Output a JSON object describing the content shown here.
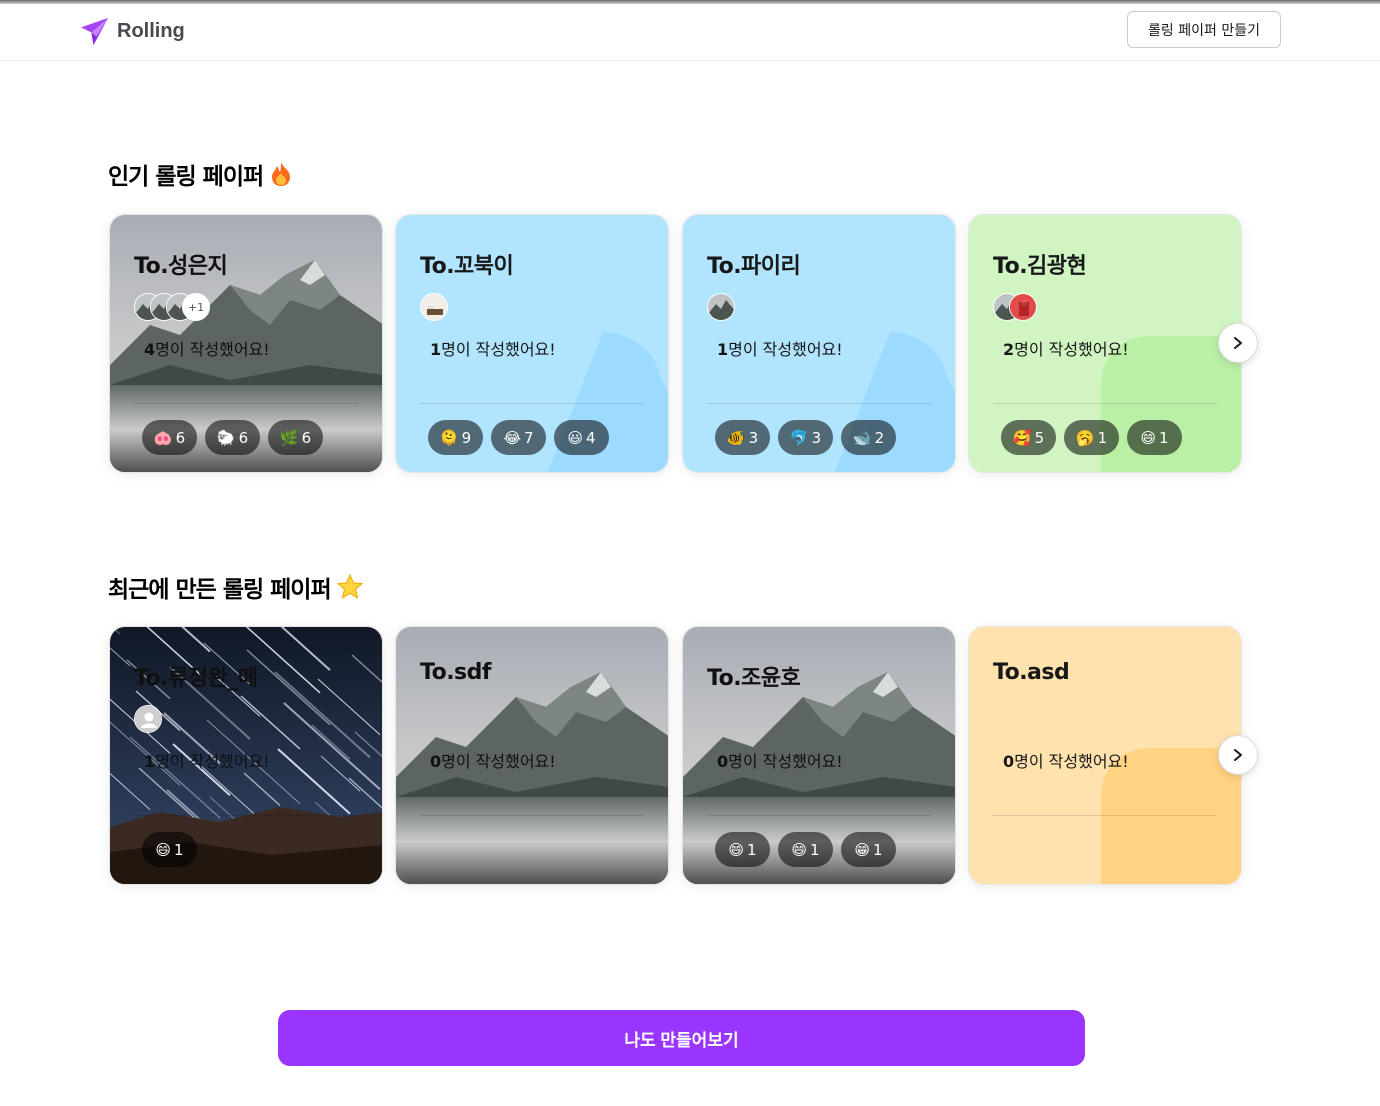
{
  "header": {
    "logo_text": "Rolling",
    "create_button": "롤링 페이퍼 만들기"
  },
  "popular": {
    "title": "인기 롤링 페이퍼",
    "title_icon": "fire-emoji",
    "cards": [
      {
        "to": "To.성은지",
        "bg_type": "mountain-image",
        "avatars": [
          "mountain",
          "mountain",
          "mountain"
        ],
        "more": "+1",
        "count_num": "4",
        "count_text": "명이 작성했어요!",
        "reactions": [
          {
            "emoji": "🐽",
            "count": "6"
          },
          {
            "emoji": "🐑",
            "count": "6"
          },
          {
            "emoji": "🌿",
            "count": "6"
          }
        ]
      },
      {
        "to": "To.꼬북이",
        "bg_type": "blue",
        "avatars": [
          "room"
        ],
        "more": "",
        "count_num": "1",
        "count_text": "명이 작성했어요!",
        "reactions": [
          {
            "emoji": "🫠",
            "count": "9"
          },
          {
            "emoji": "😂",
            "count": "7"
          },
          {
            "emoji": "😃",
            "count": "4"
          }
        ]
      },
      {
        "to": "To.파이리",
        "bg_type": "blue",
        "avatars": [
          "mountain"
        ],
        "more": "",
        "count_num": "1",
        "count_text": "명이 작성했어요!",
        "reactions": [
          {
            "emoji": "🐠",
            "count": "3"
          },
          {
            "emoji": "🐬",
            "count": "3"
          },
          {
            "emoji": "🐋",
            "count": "2"
          }
        ]
      },
      {
        "to": "To.김광현",
        "bg_type": "green",
        "avatars": [
          "mountain",
          "red"
        ],
        "more": "",
        "count_num": "2",
        "count_text": "명이 작성했어요!",
        "reactions": [
          {
            "emoji": "🥰",
            "count": "5"
          },
          {
            "emoji": "🥱",
            "count": "1"
          },
          {
            "emoji": "😄",
            "count": "1"
          }
        ]
      }
    ]
  },
  "recent": {
    "title": "최근에 만든 롤링 페이퍼",
    "title_icon": "star-emoji",
    "cards": [
      {
        "to": "To.류정완_메",
        "bg_type": "star-image",
        "avatars": [
          "default"
        ],
        "more": "",
        "count_num": "1",
        "count_text": "명이 작성했어요!",
        "reactions": [
          {
            "emoji": "😄",
            "count": "1"
          }
        ]
      },
      {
        "to": "To.sdf",
        "bg_type": "mountain-image",
        "avatars": [],
        "more": "",
        "count_num": "0",
        "count_text": "명이 작성했어요!",
        "reactions": []
      },
      {
        "to": "To.조윤호",
        "bg_type": "mountain-image",
        "avatars": [],
        "more": "",
        "count_num": "0",
        "count_text": "명이 작성했어요!",
        "reactions": [
          {
            "emoji": "😄",
            "count": "1"
          },
          {
            "emoji": "😄",
            "count": "1"
          },
          {
            "emoji": "😁",
            "count": "1"
          }
        ]
      },
      {
        "to": "To.asd",
        "bg_type": "beige",
        "avatars": [],
        "more": "",
        "count_num": "0",
        "count_text": "명이 작성했어요!",
        "reactions": []
      }
    ]
  },
  "cta": {
    "label": "나도 만들어보기"
  },
  "colors": {
    "brand": "#9935ff",
    "blue": "#b1e4ff",
    "green": "#d0f5c3",
    "beige": "#ffe2ad"
  }
}
